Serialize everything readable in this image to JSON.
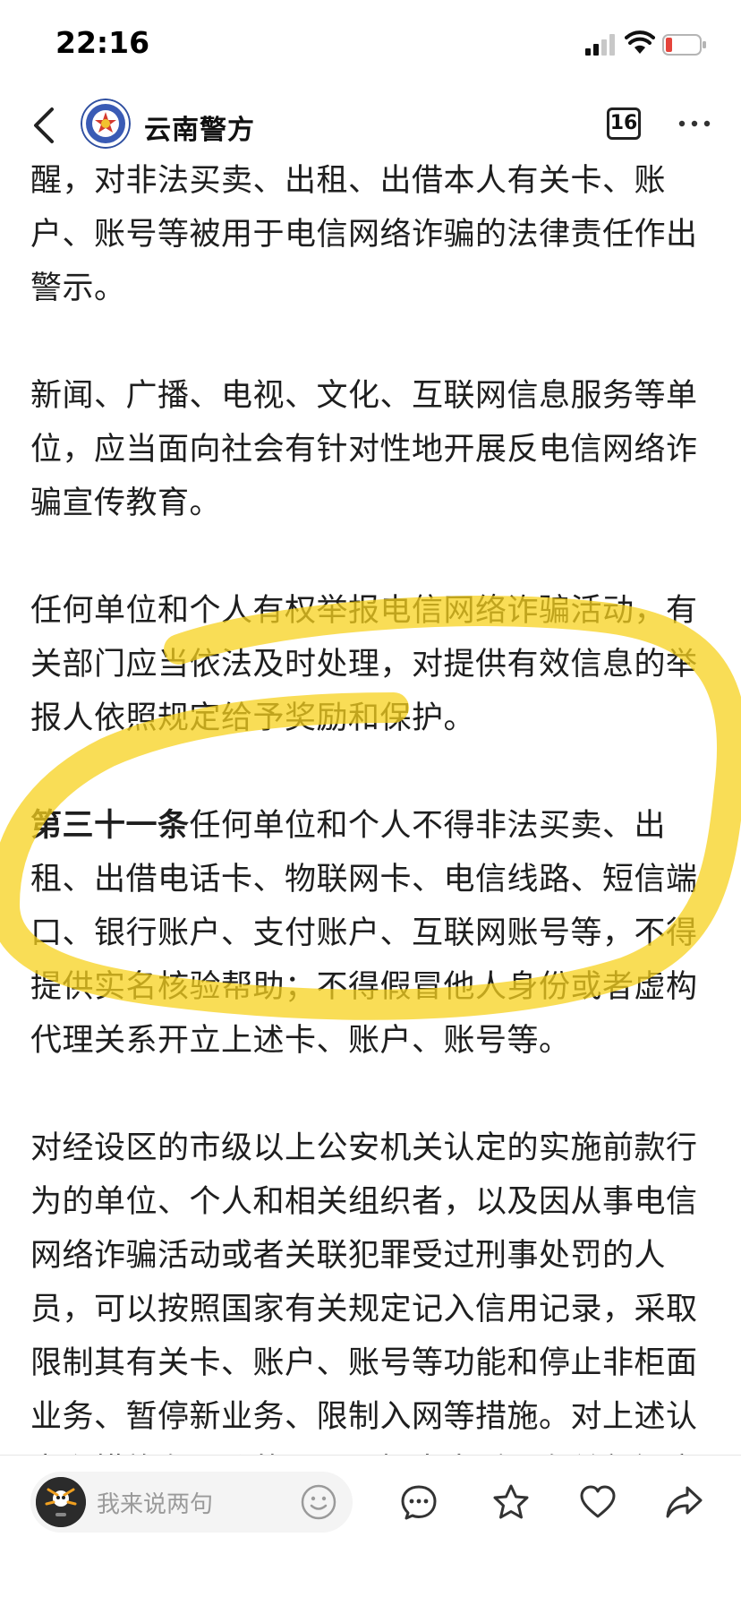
{
  "status_bar": {
    "time": "22:16",
    "signal_icon": "signal-icon",
    "wifi_icon": "wifi-icon",
    "battery_icon": "battery-low-icon",
    "battery_color": "#e5443c"
  },
  "nav": {
    "back_icon": "chevron-left-icon",
    "account_name": "云南警方",
    "count": "16",
    "more_icon": "more-dots-icon"
  },
  "article": {
    "p1": "醒，对非法买卖、出租、出借本人有关卡、账户、账号等被用于电信网络诈骗的法律责任作出警示。",
    "p2": "新闻、广播、电视、文化、互联网信息服务等单位，应当面向社会有针对性地开展反电信网络诈骗宣传教育。",
    "p3": "任何单位和个人有权举报电信网络诈骗活动，有关部门应当依法及时处理，对提供有效信息的举报人依照规定给予奖励和保护。",
    "p4_heading": "第三十一条",
    "p4_body": "任何单位和个人不得非法买卖、出租、出借电话卡、物联网卡、电信线路、短信端口、银行账户、支付账户、互联网账号等，不得提供实名核验帮助；不得假冒他人身份或者虚构代理关系开立上述卡、账户、账号等。",
    "p5": "对经设区的市级以上公安机关认定的实施前款行为的单位、个人和相关组织者，以及因从事电信网络诈骗活动或者关联犯罪受过刑事处罚的人员，可以按照国家有关规定记入信用记录，采取限制其有关卡、账户、账号等功能和停止非柜面业务、暂停新业务、限制入网等措施。对上述认定和措施有异议的，可以提出申诉，有关部门应当建立健全申诉渠道、信用修复和救济制度。具"
  },
  "highlight": {
    "color": "#f7d21e"
  },
  "toolbar": {
    "comment_placeholder": "我来说两句",
    "icons": [
      "comment-icon",
      "star-icon",
      "heart-icon",
      "share-icon"
    ]
  }
}
